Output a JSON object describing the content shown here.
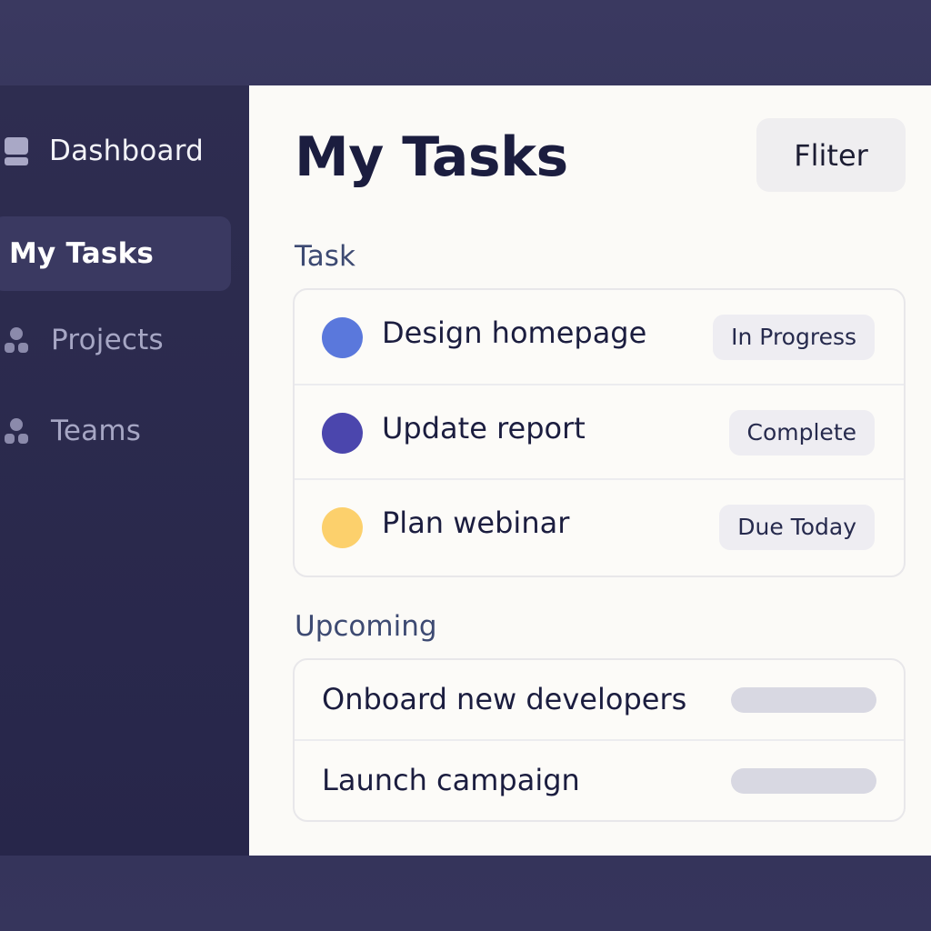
{
  "sidebar": {
    "items": [
      {
        "label": "Dashboard",
        "icon": "monitor-icon"
      },
      {
        "label": "My Tasks",
        "icon": ""
      },
      {
        "label": "Projects",
        "icon": "user-icon"
      },
      {
        "label": "Teams",
        "icon": "user-icon"
      }
    ],
    "active_item": "My Tasks"
  },
  "main": {
    "title": "My Tasks",
    "filter_label": "Fliter",
    "task_section_label": "Task",
    "tasks": [
      {
        "title": "Design homepage",
        "status": "In Progress",
        "color": "#5a78dc"
      },
      {
        "title": "Update report",
        "status": "Complete",
        "color": "#4b46ad"
      },
      {
        "title": "Plan webinar",
        "status": "Due Today",
        "color": "#fcd06c"
      }
    ],
    "upcoming_section_label": "Upcoming",
    "upcoming": [
      {
        "title": "Onboard new developers"
      },
      {
        "title": "Launch campaign"
      }
    ]
  }
}
